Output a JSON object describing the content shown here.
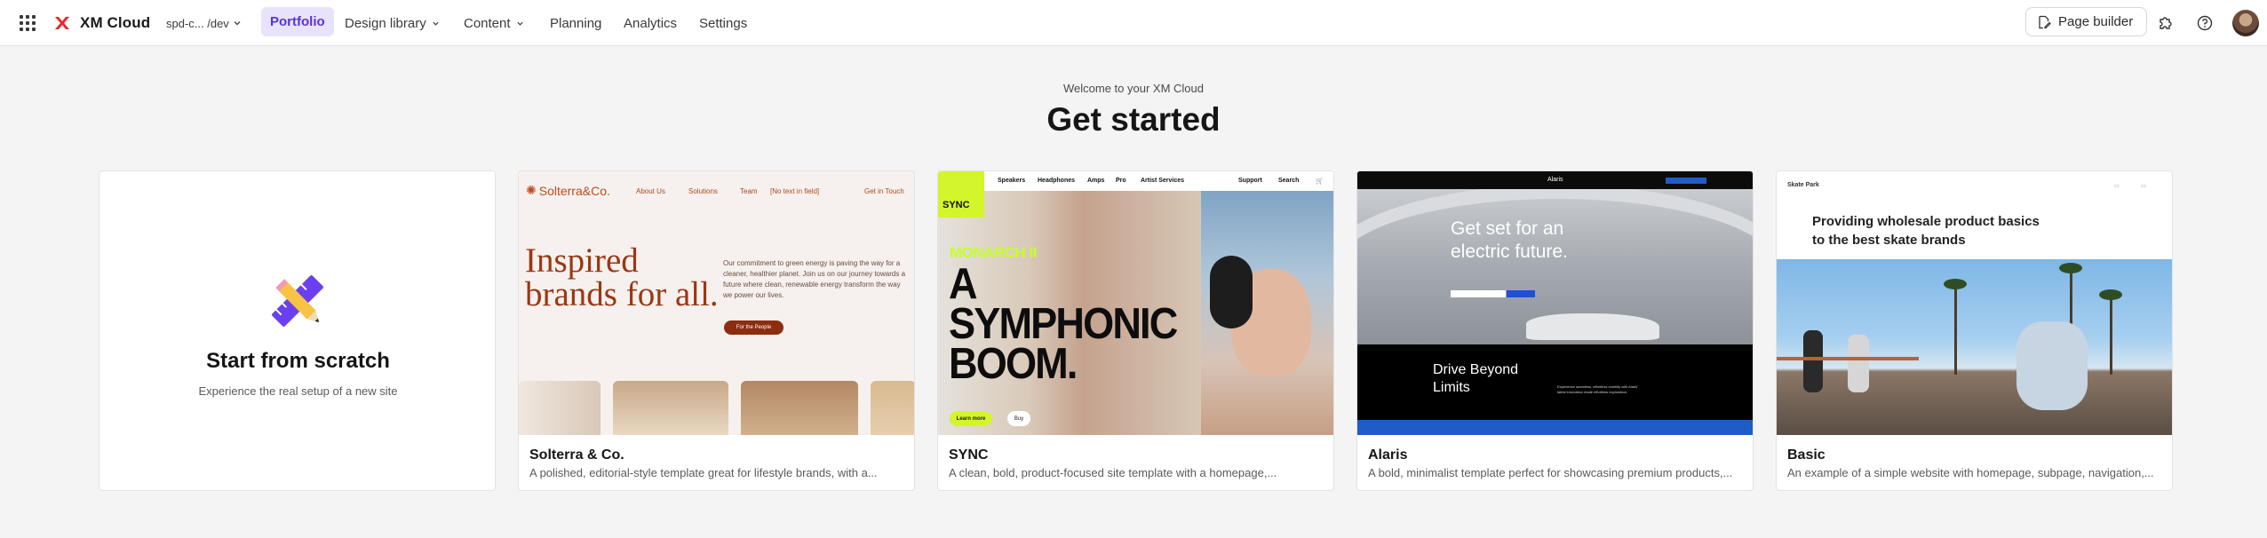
{
  "app": {
    "name": "XM Cloud",
    "environment": "spd-c... /dev"
  },
  "nav": {
    "items": [
      {
        "label": "Portfolio",
        "active": true,
        "dropdown": false
      },
      {
        "label": "Design library",
        "active": false,
        "dropdown": true
      },
      {
        "label": "Content",
        "active": false,
        "dropdown": true
      },
      {
        "label": "Planning",
        "active": false,
        "dropdown": false
      },
      {
        "label": "Analytics",
        "active": false,
        "dropdown": false
      },
      {
        "label": "Settings",
        "active": false,
        "dropdown": false
      }
    ],
    "page_builder_label": "Page builder",
    "icons": [
      "apps-grid-icon",
      "extensions-icon",
      "help-icon",
      "avatar"
    ]
  },
  "heading": {
    "welcome": "Welcome to your XM Cloud",
    "title": "Get started"
  },
  "scratch": {
    "title": "Start from scratch",
    "description": "Experience the real setup of a new site"
  },
  "templates": [
    {
      "title": "Solterra & Co.",
      "description": "A polished, editorial-style template great for lifestyle brands, with a...",
      "preview": {
        "logo": "Solterra&Co.",
        "nav": [
          "About Us",
          "Solutions",
          "Team",
          "[No text in field]",
          "Get in Touch"
        ],
        "hero": "Inspired brands for all.",
        "body": "Our commitment to green energy is paving the way for a cleaner, healthier planet. Join us on our journey towards a future where clean, renewable energy transform the way we power our lives.",
        "button": "For the People"
      }
    },
    {
      "title": "SYNC",
      "description": "A clean, bold, product-focused site template with a homepage,...",
      "preview": {
        "logo": "SYNC",
        "nav": [
          "Speakers",
          "Headphones",
          "Amps",
          "Pro",
          "Artist Services",
          "Support",
          "Search"
        ],
        "tag": "MONARCH II",
        "hero": "A SYMPHONIC BOOM.",
        "button_primary": "Learn more",
        "button_secondary": "Buy"
      }
    },
    {
      "title": "Alaris",
      "description": "A bold, minimalist template perfect for showcasing premium products,...",
      "preview": {
        "logo": "Alaris",
        "hero": "Get set for an electric future.",
        "section": "Drive Beyond Limits",
        "section_body": "Experience seamless, effortless mobility with Alaris' latest innovation made effortless exploration."
      }
    },
    {
      "title": "Basic",
      "description": "An example of a simple website with homepage, subpage, navigation,...",
      "preview": {
        "logo": "Skate Park",
        "hero": "Providing wholesale product basics to the best skate brands"
      }
    }
  ],
  "colors": {
    "accent": "#5a32d6",
    "accent_bg": "#e8e3fb",
    "brand_red": "#e8262b",
    "page_bg": "#f4f4f5"
  }
}
